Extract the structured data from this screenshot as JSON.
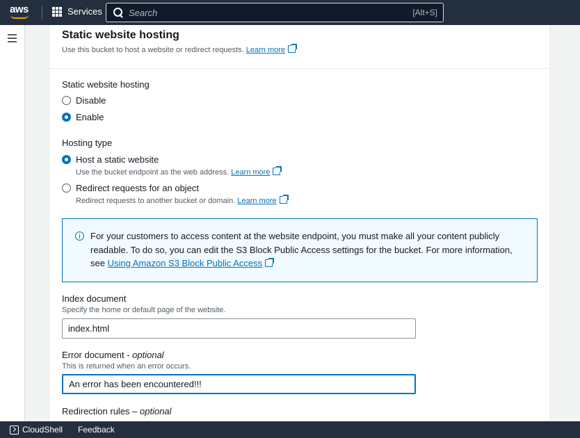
{
  "nav": {
    "logo": "aws",
    "services_label": "Services",
    "search_placeholder": "Search",
    "search_shortcut": "[Alt+S]"
  },
  "panel": {
    "title": "Static website hosting",
    "description": "Use this bucket to host a website or redirect requests.",
    "learn_more": "Learn more",
    "hosting_label": "Static website hosting",
    "hosting_options": [
      {
        "label": "Disable",
        "checked": false
      },
      {
        "label": "Enable",
        "checked": true
      }
    ],
    "hosting_type_label": "Hosting type",
    "hosting_types": [
      {
        "label": "Host a static website",
        "desc": "Use the bucket endpoint as the web address.",
        "link": "Learn more",
        "checked": true
      },
      {
        "label": "Redirect requests for an object",
        "desc": "Redirect requests to another bucket or domain.",
        "link": "Learn more",
        "checked": false
      }
    ],
    "alert": {
      "text": "For your customers to access content at the website endpoint, you must make all your content publicly readable. To do so, you can edit the S3 Block Public Access settings for the bucket. For more information, see",
      "link": "Using Amazon S3 Block Public Access"
    },
    "index": {
      "label": "Index document",
      "desc": "Specify the home or default page of the website.",
      "value": "index.html"
    },
    "error": {
      "label": "Error document - ",
      "optional": "optional",
      "desc": "This is returned when an error occurs.",
      "value": "An error has been encountered!!!"
    },
    "redirection": {
      "label": "Redirection rules – ",
      "optional": "optional"
    }
  },
  "bottom": {
    "cloudshell": "CloudShell",
    "feedback": "Feedback"
  },
  "colors": {
    "nav_bg": "#232f3e",
    "accent": "#0073bb",
    "aws_orange": "#ff9900"
  }
}
